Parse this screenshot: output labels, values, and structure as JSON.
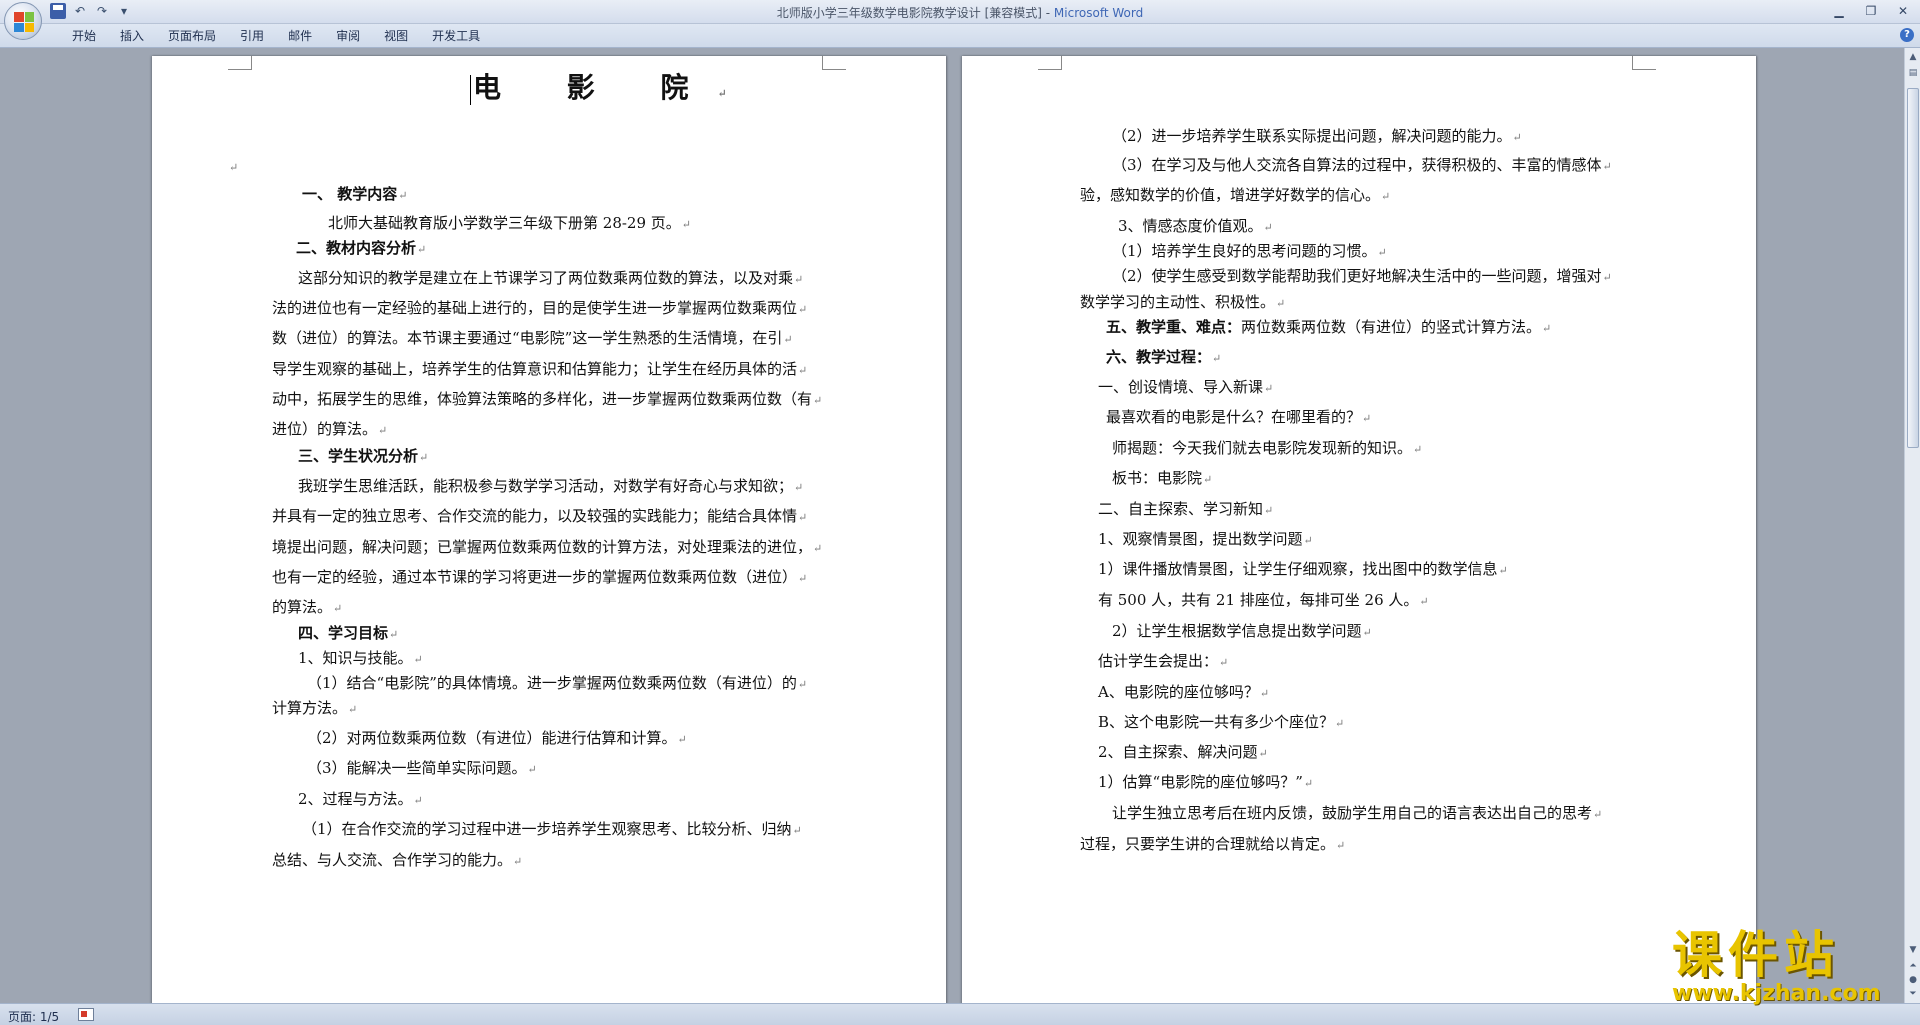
{
  "window": {
    "title": "北师版小学三年级数学电影院教学设计 [兼容模式] - ",
    "app_name": "Microsoft Word"
  },
  "quick_access": [
    "save-icon",
    "undo-icon",
    "redo-icon",
    "customize-icon"
  ],
  "ribbon_tabs": [
    "开始",
    "插入",
    "页面布局",
    "引用",
    "邮件",
    "审阅",
    "视图",
    "开发工具"
  ],
  "document": {
    "title": "电  影  院",
    "left_page": [
      "",
      "一、  教学内容",
      "北师大基础教育版小学数学三年级下册第 28-29 页。",
      "二、教材内容分析",
      "这部分知识的教学是建立在上节课学习了两位数乘两位数的算法，以及对乘",
      "法的进位也有一定经验的基础上进行的，目的是使学生进一步掌握两位数乘两位",
      "数（进位）的算法。本节课主要通过“电影院”这一学生熟悉的生活情境，在引",
      "导学生观察的基础上，培养学生的估算意识和估算能力；让学生在经历具体的活",
      "动中，拓展学生的思维，体验算法策略的多样化，进一步掌握两位数乘两位数（有",
      "进位）的算法。",
      "三、学生状况分析",
      "我班学生思维活跃，能积极参与数学学习活动，对数学有好奇心与求知欲；",
      "并具有一定的独立思考、合作交流的能力，以及较强的实践能力；能结合具体情",
      "境提出问题，解决问题；已掌握两位数乘两位数的计算方法，对处理乘法的进位，",
      "也有一定的经验，通过本节课的学习将更进一步的掌握两位数乘两位数（进位）",
      "的算法。",
      "四、学习目标",
      "1、知识与技能。",
      "（1）结合“电影院”的具体情境。进一步掌握两位数乘两位数（有进位）的",
      "计算方法。",
      "（2）对两位数乘两位数（有进位）能进行估算和计算。",
      "（3）能解决一些简单实际问题。",
      "2、过程与方法。",
      "（1）在合作交流的学习过程中进一步培养学生观察思考、比较分析、归纳",
      "总结、与人交流、合作学习的能力。"
    ],
    "right_page": [
      "（2）进一步培养学生联系实际提出问题，解决问题的能力。",
      "（3）在学习及与他人交流各自算法的过程中，获得积极的、丰富的情感体",
      "验，感知数学的价值，增进学好数学的信心。",
      "3、情感态度价值观。",
      "（1）培养学生良好的思考问题的习惯。",
      "（2）使学生感受到数学能帮助我们更好地解决生活中的一些问题，增强对",
      "数学学习的主动性、积极性。",
      "五、教学重、难点：",
      "两位数乘两位数（有进位）的竖式计算方法。",
      "六、教学过程：",
      "一、创设情境、导入新课",
      "最喜欢看的电影是什么？在哪里看的？",
      "师揭题：今天我们就去电影院发现新的知识。",
      "板书：电影院",
      "二、自主探索、学习新知",
      "1、观察情景图，提出数学问题",
      "1）课件播放情景图，让学生仔细观察，找出图中的数学信息",
      "有 500 人，共有 21 排座位，每排可坐 26 人。",
      "2）让学生根据数学信息提出数学问题",
      "估计学生会提出：",
      "A、电影院的座位够吗？",
      "B、这个电影院一共有多少个座位？",
      "2、自主探索、解决问题",
      "1）估算“电影院的座位够吗？”",
      "让学生独立思考后在班内反馈，鼓励学生用自己的语言表达出自己的思考",
      "过程，只要学生讲的合理就给以肯定。"
    ]
  },
  "status": {
    "page_indicator": "页面: 1/5"
  },
  "watermark": {
    "text": "课件站",
    "url": "www.kjzhan.com"
  },
  "colors": {
    "ribbon_bg": "#dfe7f3",
    "workspace_bg": "#9ea6b3",
    "title_app_blue": "#3f67b5",
    "watermark_yellow": "#e8c400"
  }
}
